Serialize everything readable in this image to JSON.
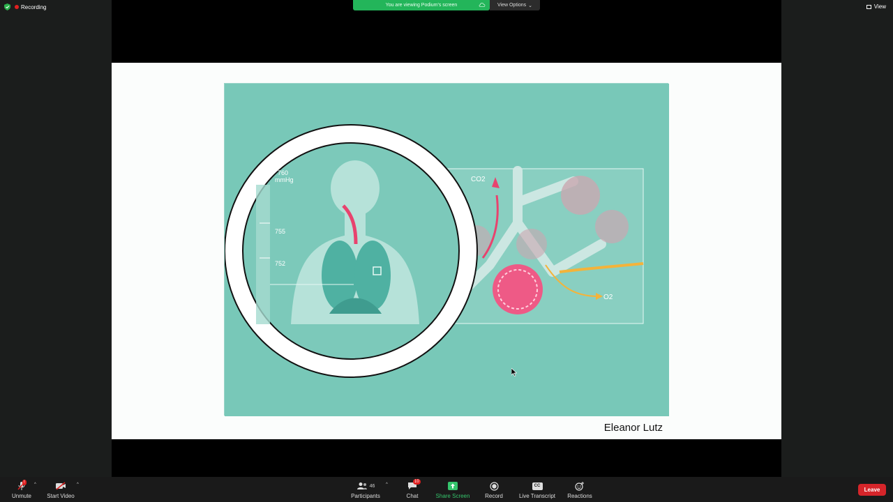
{
  "status": {
    "recording_label": "Recording",
    "view_label": "View"
  },
  "share_banner": {
    "text": "You are viewing Podium's screen",
    "options_label": "View Options"
  },
  "slide": {
    "labels": {
      "pressure_top": "760",
      "pressure_unit": "mmHg",
      "pressure_mid": "755",
      "pressure_low": "752",
      "co2": "CO2",
      "o2": "O2"
    },
    "credit": "Eleanor Lutz"
  },
  "toolbar": {
    "unmute": "Unmute",
    "unmute_badge": "!",
    "start_video": "Start Video",
    "participants": "Participants",
    "participants_count": "46",
    "chat": "Chat",
    "chat_badge": "10",
    "share_screen": "Share Screen",
    "record": "Record",
    "cc_icon_text": "CC",
    "live_transcript": "Live Transcript",
    "reactions": "Reactions",
    "leave": "Leave"
  },
  "colors": {
    "recording": "#e02020",
    "share_green": "#23b55a",
    "leave_red": "#d6252a",
    "slide_teal": "#78c8b8"
  }
}
